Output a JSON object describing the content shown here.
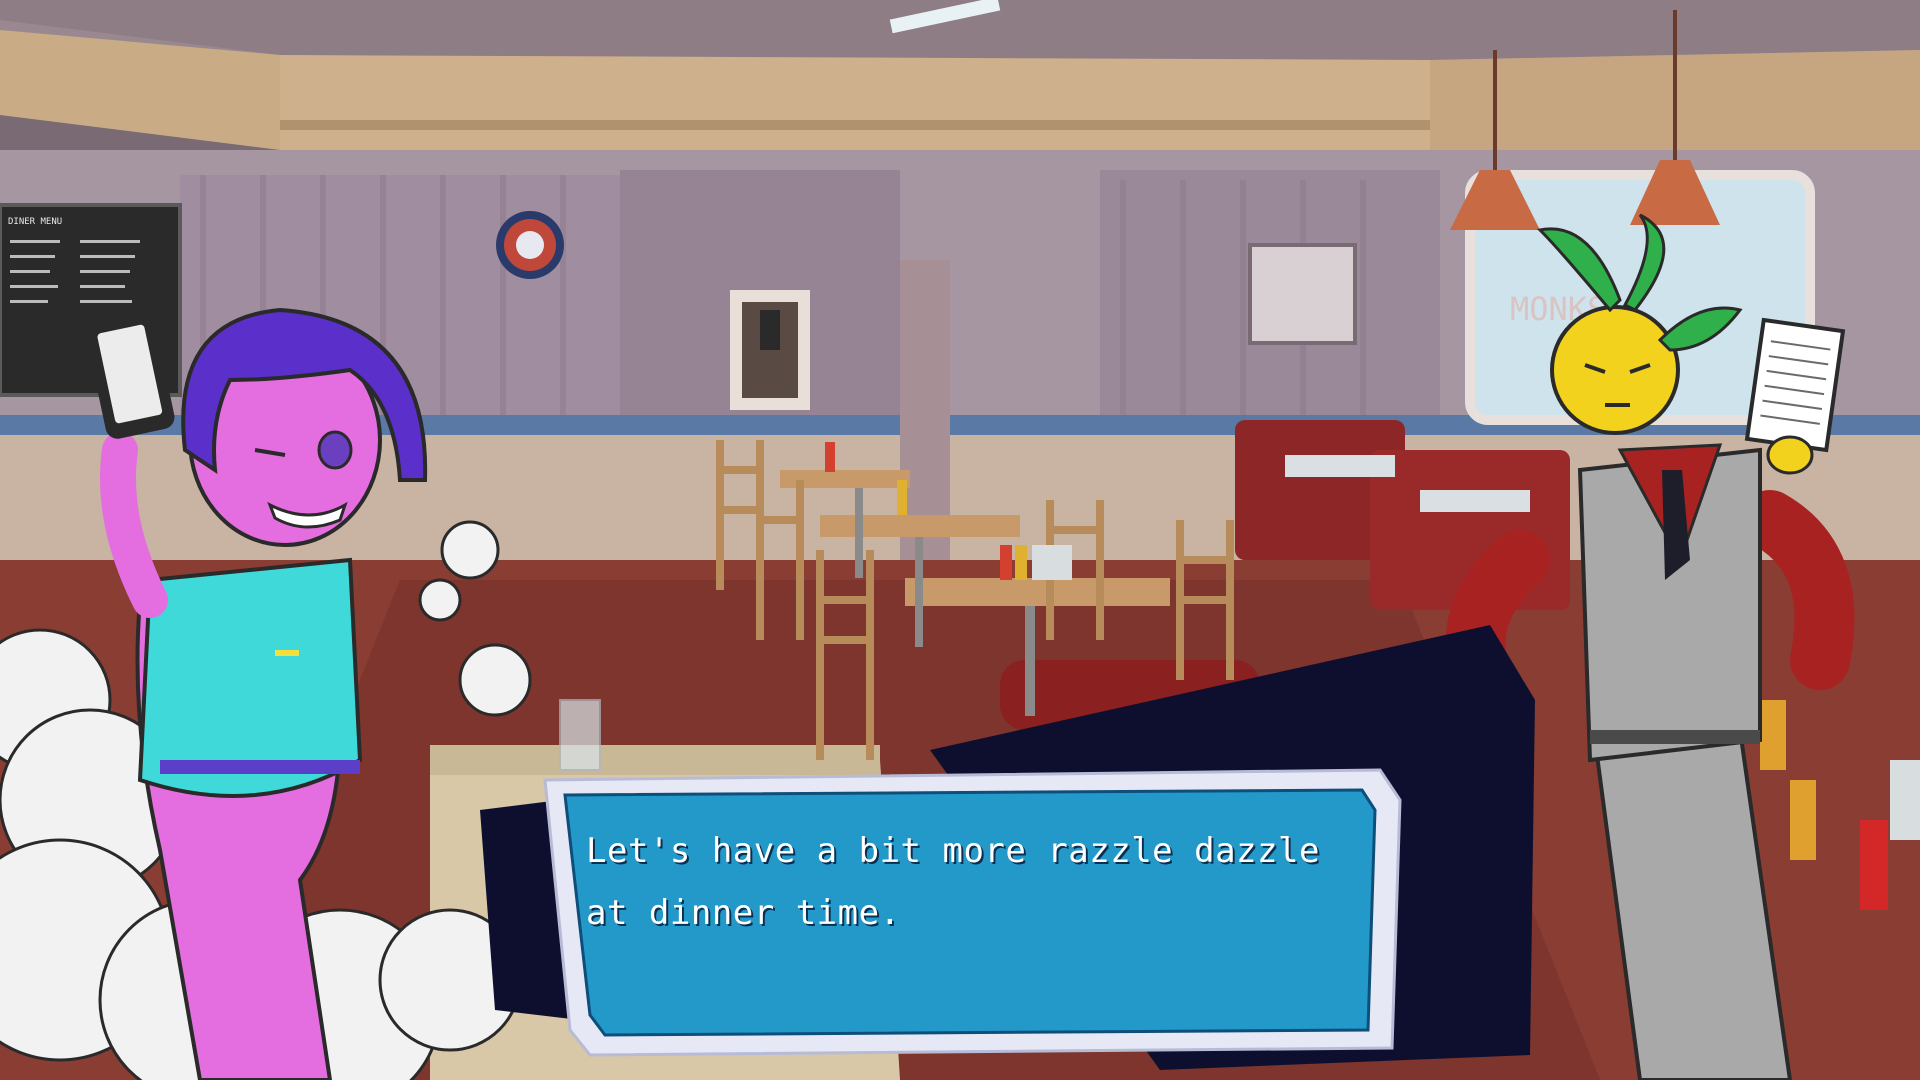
{
  "scene": {
    "location": "diner",
    "menu_board_heading": "DINER MENU"
  },
  "dialogue": {
    "text": "Let's have a bit more razzle dazzle at dinner time."
  },
  "characters": {
    "left": {
      "icon": "waitress-character",
      "color": "#e46ee0",
      "hair": "#5b2fc9",
      "uniform": "#3fd9d9"
    },
    "right": {
      "icon": "lemon-head-waiter-character",
      "color": "#f2d21c",
      "shirt": "#a82222",
      "vest": "#a9a9a9"
    }
  },
  "colors": {
    "dialogue_box": "#2299c8",
    "dialogue_border": "#e6e8f6",
    "dialogue_tail": "#0e0f2e"
  }
}
